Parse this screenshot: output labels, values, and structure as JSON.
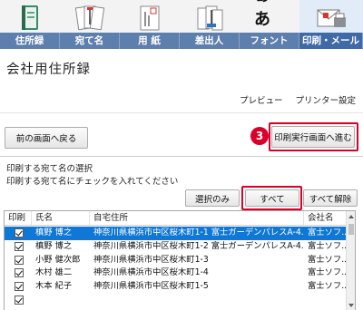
{
  "ribbon": {
    "tabs": [
      {
        "label": "住所録",
        "icon": "address-book-icon"
      },
      {
        "label": "宛て名",
        "icon": "address-labels-icon"
      },
      {
        "label": "用 紙",
        "icon": "paper-icon"
      },
      {
        "label": "差出人",
        "icon": "sender-icon"
      },
      {
        "label": "フォント",
        "icon": "font-icon"
      },
      {
        "label": "印刷・メール",
        "icon": "print-mail-icon"
      }
    ],
    "font_glyph": "ぁあ",
    "active_tab": "印刷・メール"
  },
  "page": {
    "title": "会社用住所録",
    "preview_link": "プレビュー",
    "printer_settings_link": "プリンター設定"
  },
  "buttons": {
    "back": "前の画面へ戻る",
    "print_go": "印刷実行画面へ進む",
    "select_only": "選択のみ",
    "all": "すべて",
    "clear_all": "すべて解除"
  },
  "callout": {
    "step": "3",
    "color": "#d9002a"
  },
  "section": {
    "title": "印刷する宛て名の選択",
    "description": "印刷する宛て名にチェックを入れてください"
  },
  "table": {
    "headers": [
      "印刷",
      "氏名",
      "自宅住所",
      "会社名"
    ],
    "rows": [
      {
        "checked": true,
        "name": "槙野 博之",
        "address": "神奈川県横浜市中区桜木町1-1 富士ガーデンパレスA-4...",
        "company": "富士ソフ...",
        "selected": true
      },
      {
        "checked": true,
        "name": "槙野 博之",
        "address": "神奈川県横浜市中区桜木町1-2 富士ガーデンパレスA-4...",
        "company": "富士ソフ...",
        "selected": false
      },
      {
        "checked": true,
        "name": "小野 健次郎",
        "address": "神奈川県横浜市中区桜木町1-3",
        "company": "富士ソフ...",
        "selected": false
      },
      {
        "checked": true,
        "name": "木村 雄二",
        "address": "神奈川県横浜市中区桜木町1-4",
        "company": "富士ソフ...",
        "selected": false
      },
      {
        "checked": true,
        "name": "木本 紀子",
        "address": "神奈川県横浜市中区桜木町1-5",
        "company": "富士ソフ...",
        "selected": false
      },
      {
        "checked": true,
        "name": "",
        "address": "",
        "company": "",
        "selected": false
      }
    ]
  },
  "colors": {
    "ribbon_label_bg": "#5d7fae",
    "selected_row": "#0f77d6",
    "highlight_red": "#d9002a"
  }
}
